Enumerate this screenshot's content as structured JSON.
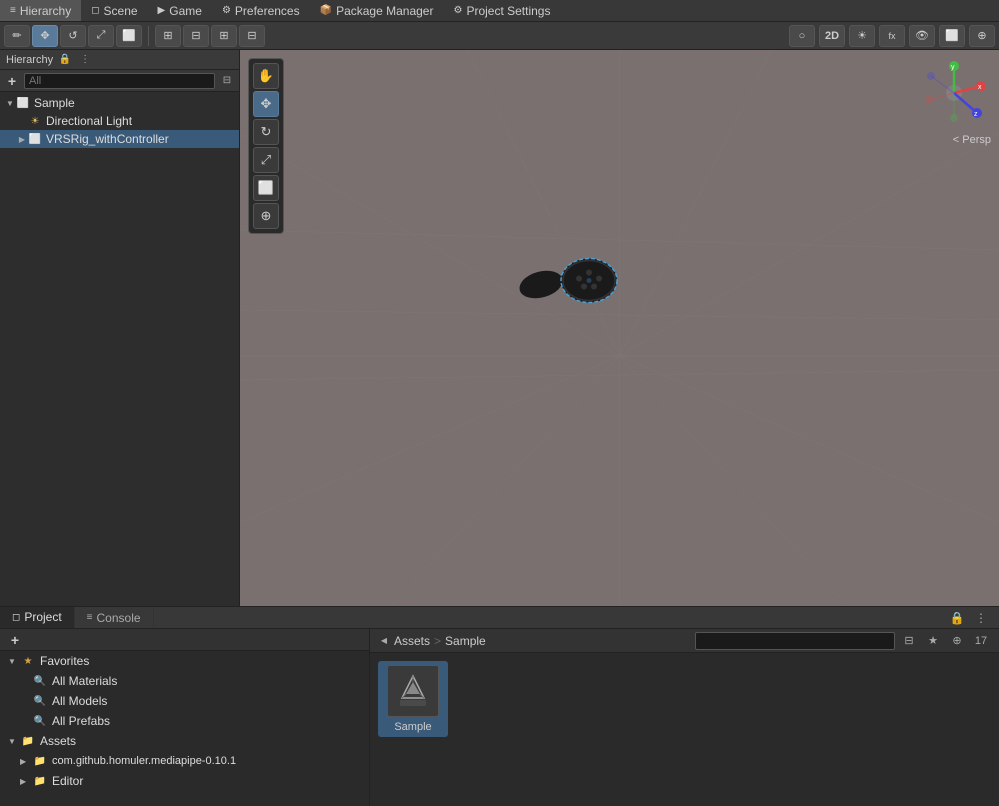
{
  "topMenu": {
    "items": [
      {
        "id": "hierarchy",
        "label": "Hierarchy",
        "icon": "≡"
      },
      {
        "id": "scene",
        "label": "Scene",
        "icon": "◻"
      },
      {
        "id": "game",
        "label": "Game",
        "icon": "▶"
      },
      {
        "id": "preferences",
        "label": "Preferences",
        "icon": "⚙"
      },
      {
        "id": "package-manager",
        "label": "Package Manager",
        "icon": "📦"
      },
      {
        "id": "project-settings",
        "label": "Project Settings",
        "icon": "⚙"
      }
    ]
  },
  "toolbar": {
    "tools": [
      {
        "id": "pencil",
        "icon": "✏",
        "active": false
      },
      {
        "id": "transform",
        "icon": "✥",
        "active": false
      },
      {
        "id": "grid",
        "icon": "⊞",
        "active": false
      },
      {
        "id": "grid2",
        "icon": "⊟",
        "active": false
      },
      {
        "id": "ruler",
        "icon": "⊞",
        "active": false
      }
    ],
    "right": {
      "sphere": "○",
      "2d": "2D",
      "light": "☀",
      "fx": "fx",
      "eye": "👁",
      "cube": "⬜",
      "globe": "⊕"
    }
  },
  "hierarchy": {
    "title": "Hierarchy",
    "searchPlaceholder": "All",
    "items": [
      {
        "id": "sample",
        "label": "Sample",
        "icon": "◻",
        "expanded": true,
        "indent": 0,
        "children": [
          {
            "id": "directional-light",
            "label": "Directional Light",
            "icon": "☀",
            "indent": 1
          },
          {
            "id": "vrs-rig",
            "label": "VRSRig_withController",
            "icon": "◻",
            "indent": 1,
            "selected": true
          }
        ]
      }
    ]
  },
  "sceneView": {
    "perspLabel": "< Persp",
    "gizmoColors": {
      "x": "#ff4444",
      "y": "#44ff44",
      "z": "#4444ff"
    }
  },
  "bottomPanel": {
    "tabs": [
      {
        "id": "project",
        "label": "Project",
        "icon": "◻",
        "active": true
      },
      {
        "id": "console",
        "label": "Console",
        "icon": "≡",
        "active": false
      }
    ],
    "projectTree": {
      "items": [
        {
          "id": "favorites",
          "label": "Favorites",
          "icon": "★",
          "expanded": true,
          "indent": 0
        },
        {
          "id": "all-materials",
          "label": "All Materials",
          "icon": "🔍",
          "indent": 1
        },
        {
          "id": "all-models",
          "label": "All Models",
          "icon": "🔍",
          "indent": 1
        },
        {
          "id": "all-prefabs",
          "label": "All Prefabs",
          "icon": "🔍",
          "indent": 1
        },
        {
          "id": "assets",
          "label": "Assets",
          "icon": "📁",
          "expanded": true,
          "indent": 0
        },
        {
          "id": "com-github",
          "label": "com.github.homuler.mediapipe-0.10.1",
          "icon": "📁",
          "indent": 1
        },
        {
          "id": "editor",
          "label": "Editor",
          "icon": "📁",
          "indent": 1
        }
      ]
    },
    "breadcrumb": {
      "path": [
        "Assets",
        "Sample"
      ],
      "separator": ">"
    },
    "searchPlaceholder": "",
    "assets": [
      {
        "id": "sample-asset",
        "label": "Sample",
        "type": "unity-scene"
      }
    ]
  }
}
